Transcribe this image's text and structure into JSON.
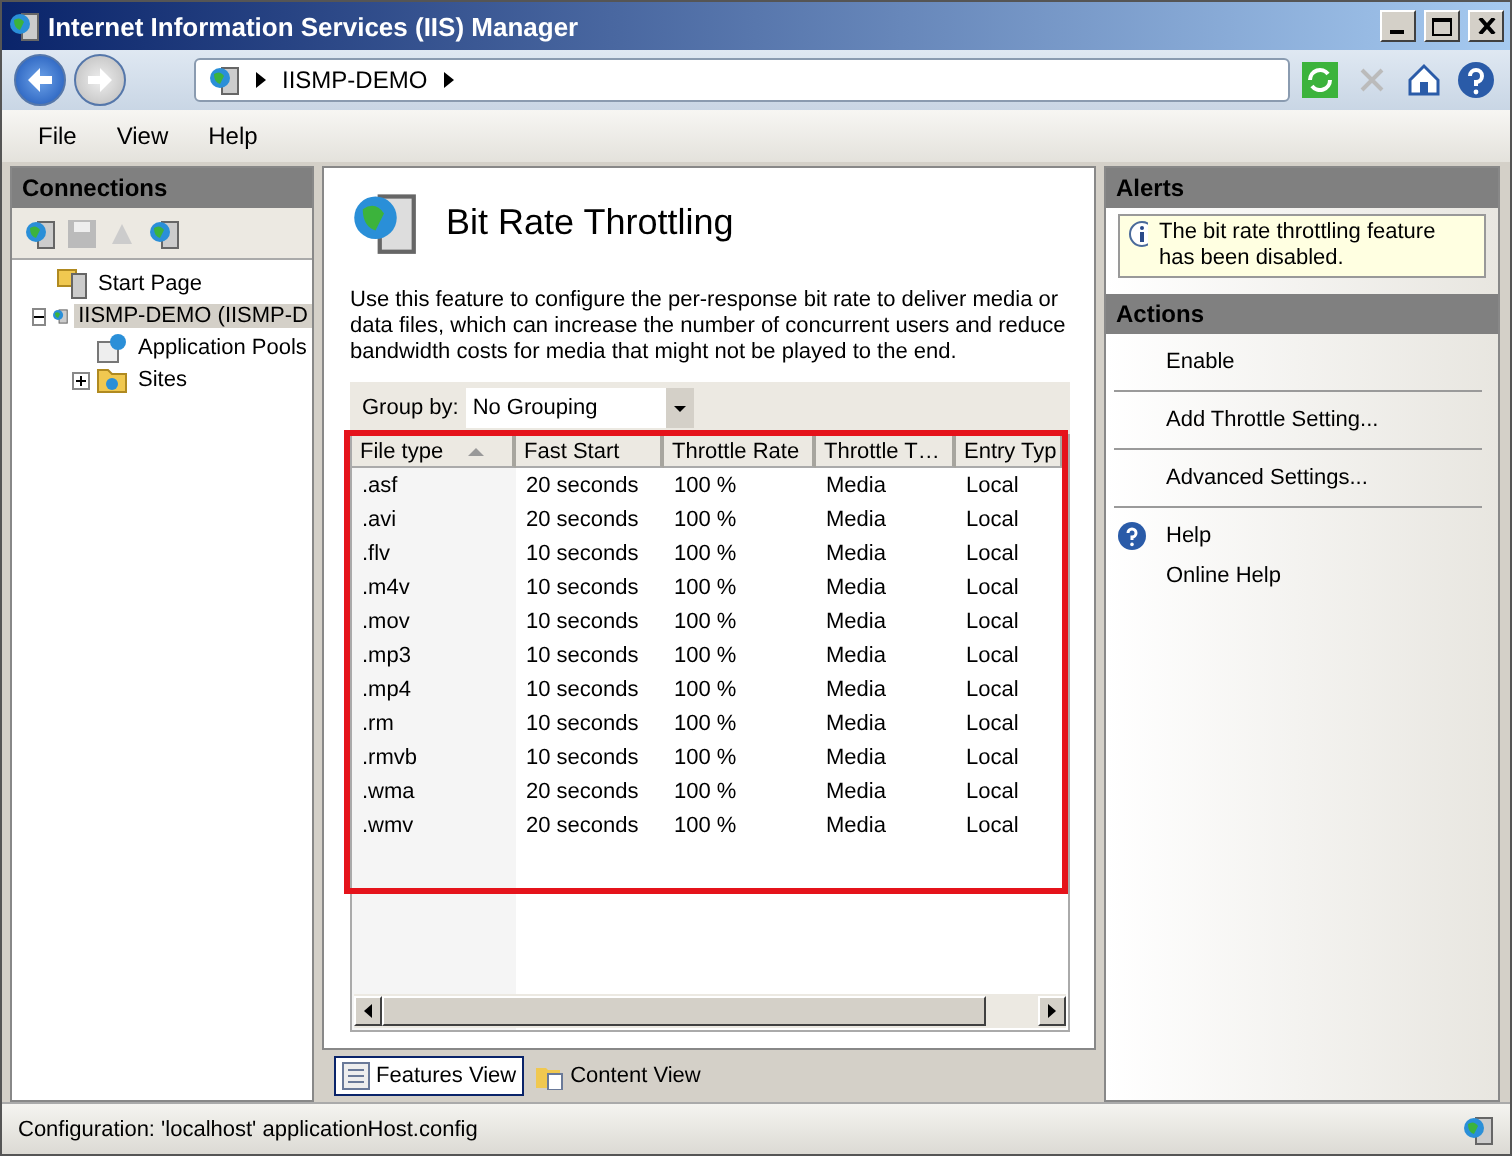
{
  "window": {
    "title": "Internet Information Services (IIS) Manager"
  },
  "address": {
    "crumbs": [
      "IISMP-DEMO"
    ]
  },
  "menu": [
    "File",
    "View",
    "Help"
  ],
  "connections": {
    "title": "Connections",
    "tree": [
      {
        "label": "Start Page",
        "kind": "page",
        "selected": false
      },
      {
        "label": "IISMP-DEMO (IISMP-D",
        "kind": "server",
        "selected": true,
        "expanded": true,
        "children": [
          {
            "label": "Application Pools",
            "kind": "pools",
            "selected": false
          },
          {
            "label": "Sites",
            "kind": "sites",
            "selected": false,
            "expanded": false
          }
        ]
      }
    ]
  },
  "feature": {
    "title": "Bit Rate Throttling",
    "description": "Use this feature to configure the per-response bit rate to deliver media or data files, which can increase the number of concurrent users and reduce bandwidth costs for media that might not be played to the end.",
    "group_by_label": "Group by:",
    "group_by_value": "No Grouping",
    "list": {
      "highlighted": true,
      "columns": [
        {
          "label": "File type",
          "sorted": true
        },
        {
          "label": "Fast Start"
        },
        {
          "label": "Throttle Rate"
        },
        {
          "label": "Throttle T…"
        },
        {
          "label": "Entry Typ"
        }
      ],
      "rows": [
        [
          ".asf",
          "20 seconds",
          "100 %",
          "Media",
          "Local"
        ],
        [
          ".avi",
          "20 seconds",
          "100 %",
          "Media",
          "Local"
        ],
        [
          ".flv",
          "10 seconds",
          "100 %",
          "Media",
          "Local"
        ],
        [
          ".m4v",
          "10 seconds",
          "100 %",
          "Media",
          "Local"
        ],
        [
          ".mov",
          "10 seconds",
          "100 %",
          "Media",
          "Local"
        ],
        [
          ".mp3",
          "10 seconds",
          "100 %",
          "Media",
          "Local"
        ],
        [
          ".mp4",
          "10 seconds",
          "100 %",
          "Media",
          "Local"
        ],
        [
          ".rm",
          "10 seconds",
          "100 %",
          "Media",
          "Local"
        ],
        [
          ".rmvb",
          "10 seconds",
          "100 %",
          "Media",
          "Local"
        ],
        [
          ".wma",
          "20 seconds",
          "100 %",
          "Media",
          "Local"
        ],
        [
          ".wmv",
          "20 seconds",
          "100 %",
          "Media",
          "Local"
        ]
      ]
    },
    "views": [
      {
        "label": "Features View",
        "selected": true
      },
      {
        "label": "Content View",
        "selected": false
      }
    ]
  },
  "alerts": {
    "title": "Alerts",
    "message": "The bit rate throttling feature has been disabled."
  },
  "actions": {
    "title": "Actions",
    "groups": [
      [
        {
          "label": "Enable",
          "icon": false
        }
      ],
      [
        {
          "label": "Add Throttle Setting...",
          "icon": false
        }
      ],
      [
        {
          "label": "Advanced Settings...",
          "icon": false
        }
      ],
      [
        {
          "label": "Help",
          "icon": true
        },
        {
          "label": "Online Help",
          "icon": false
        }
      ]
    ]
  },
  "status_bar": "Configuration: 'localhost' applicationHost.config"
}
